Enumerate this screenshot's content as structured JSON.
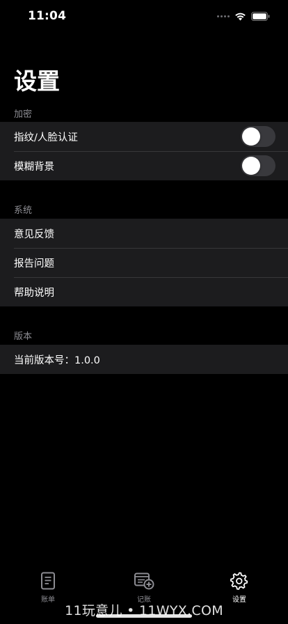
{
  "status_bar": {
    "time": "11:04"
  },
  "page": {
    "title": "设置"
  },
  "sections": {
    "encryption": {
      "header": "加密",
      "rows": [
        {
          "label": "指纹/人脸认证",
          "toggle_on": false
        },
        {
          "label": "模糊背景",
          "toggle_on": false
        }
      ]
    },
    "system": {
      "header": "系统",
      "rows": [
        {
          "label": "意见反馈"
        },
        {
          "label": "报告问题"
        },
        {
          "label": "帮助说明"
        }
      ]
    },
    "version": {
      "header": "版本",
      "rows": [
        {
          "label": "当前版本号：1.0.0"
        }
      ]
    }
  },
  "tab_bar": {
    "tabs": [
      {
        "label": "账单",
        "icon": "document-icon",
        "active": false
      },
      {
        "label": "记账",
        "icon": "add-record-icon",
        "active": false
      },
      {
        "label": "设置",
        "icon": "gear-icon",
        "active": true
      }
    ]
  },
  "watermark": {
    "text": "11玩意儿 • 11WYX.COM"
  },
  "colors": {
    "background": "#000000",
    "cell_background": "#1c1c1e",
    "section_header": "#8d8d93",
    "toggle_off": "#39393d",
    "tab_inactive": "#8d8d93",
    "tab_active": "#ffffff"
  }
}
